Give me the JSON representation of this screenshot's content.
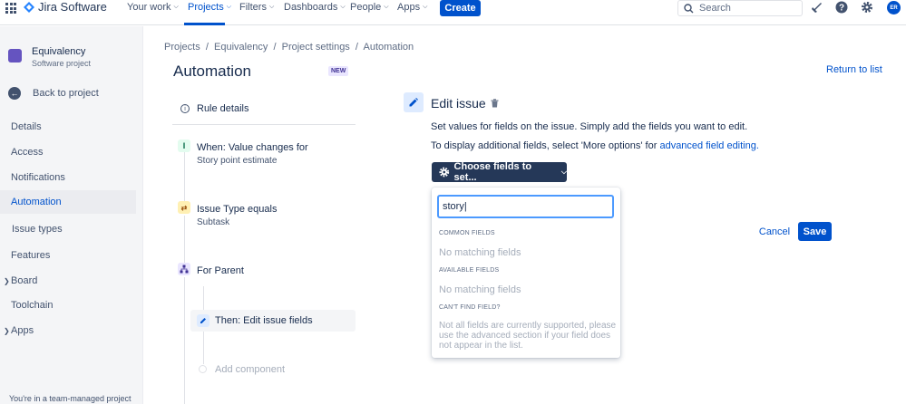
{
  "topnav": {
    "product_name": "Jira Software",
    "items": [
      {
        "label": "Your work"
      },
      {
        "label": "Projects"
      },
      {
        "label": "Filters"
      },
      {
        "label": "Dashboards"
      },
      {
        "label": "People"
      },
      {
        "label": "Apps"
      }
    ],
    "create_label": "Create",
    "search_placeholder": "Search",
    "avatar_initials": "ER",
    "accent_color": "#0052cc"
  },
  "sidebar": {
    "project_name": "Equivalency",
    "project_type": "Software project",
    "back_label": "Back to project",
    "items": [
      {
        "label": "Details"
      },
      {
        "label": "Access"
      },
      {
        "label": "Notifications"
      },
      {
        "label": "Automation"
      },
      {
        "label": "Issue types"
      },
      {
        "label": "Features"
      },
      {
        "label": "Board"
      },
      {
        "label": "Toolchain"
      },
      {
        "label": "Apps"
      }
    ],
    "footer": "You're in a team-managed project"
  },
  "main": {
    "breadcrumb": "Projects  /  Equivalency  /  Project settings  /  Automation",
    "title": "Automation",
    "badge": "NEW",
    "return_link": "Return to list",
    "rule": {
      "details_label": "Rule details",
      "trigger_title": "When: Value changes for",
      "trigger_sub": "Story point estimate",
      "condition_title": "Issue Type equals",
      "condition_sub": "Subtask",
      "branch_title": "For Parent",
      "action_title": "Then: Edit issue fields",
      "add_component": "Add component"
    }
  },
  "edit_panel": {
    "title": "Edit issue",
    "desc1": "Set values for fields on the issue. Simply add the fields you want to edit.",
    "desc2_prefix": "To display additional fields, select 'More options' for ",
    "desc2_link": "advanced field editing.",
    "choose_button": "Choose fields to set...",
    "dropdown": {
      "input_value": "story",
      "common_header": "COMMON FIELDS",
      "common_empty": "No matching fields",
      "available_header": "AVAILABLE FIELDS",
      "available_empty": "No matching fields",
      "cant_find_header": "CAN'T FIND FIELD?",
      "cant_find_note": "Not all fields are currently supported, please use the advanced section if your field does not appear in the list."
    },
    "cancel_label": "Cancel",
    "save_label": "Save"
  }
}
